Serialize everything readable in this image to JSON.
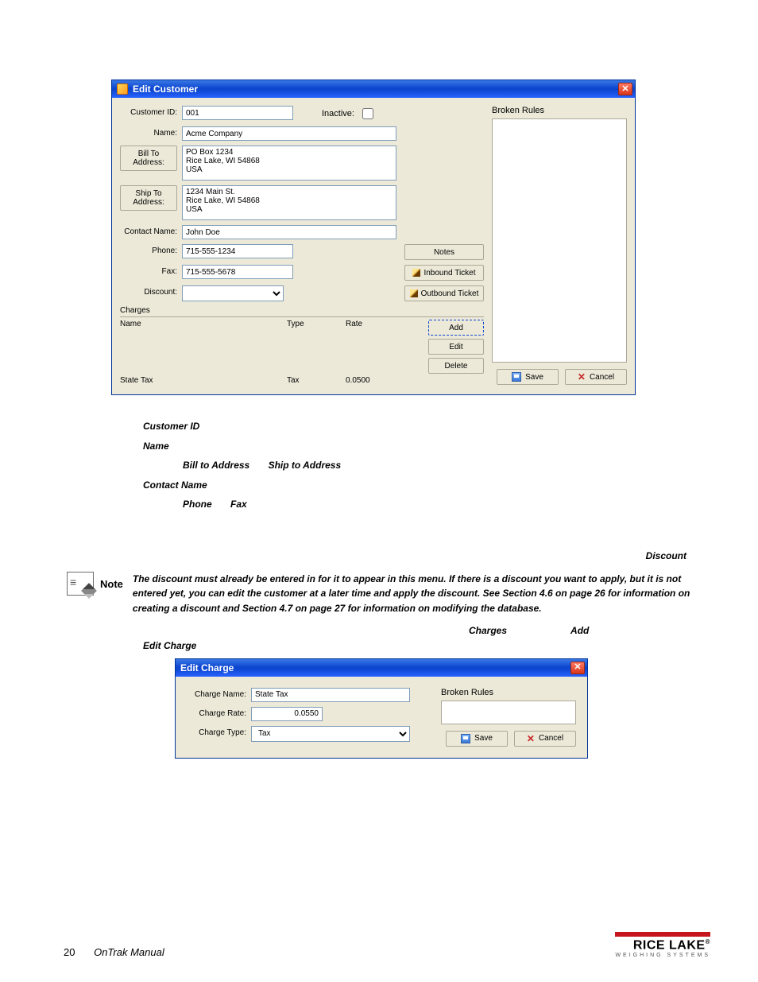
{
  "edit_customer": {
    "title": "Edit Customer",
    "close": "✕",
    "labels": {
      "customer_id": "Customer ID:",
      "inactive": "Inactive:",
      "name": "Name:",
      "bill_to": "Bill To Address:",
      "ship_to": "Ship To Address:",
      "contact_name": "Contact Name:",
      "phone": "Phone:",
      "fax": "Fax:",
      "discount": "Discount:"
    },
    "values": {
      "customer_id": "001",
      "name": "Acme Company",
      "bill_to": "PO Box 1234\nRice Lake, WI 54868\nUSA",
      "ship_to": "1234 Main St.\nRice Lake, WI 54868\nUSA",
      "contact_name": "John Doe",
      "phone": "715-555-1234",
      "fax": "715-555-5678",
      "discount": ""
    },
    "side_buttons": {
      "notes": "Notes",
      "inbound": "Inbound Ticket",
      "outbound": "Outbound Ticket"
    },
    "charges": {
      "header": "Charges",
      "cols": {
        "name": "Name",
        "type": "Type",
        "rate": "Rate"
      },
      "rows": [
        {
          "name": "State Tax",
          "type": "Tax",
          "rate": "0.0500"
        }
      ],
      "buttons": {
        "add": "Add",
        "edit": "Edit",
        "delete": "Delete"
      }
    },
    "broken_rules_label": "Broken Rules",
    "footer": {
      "save": "Save",
      "cancel": "Cancel"
    }
  },
  "doc": {
    "l1": "Customer ID",
    "l2": "Name",
    "l3a": "Bill to Address",
    "l3b": "Ship to Address",
    "l4": "Contact Name",
    "l5a": "Phone",
    "l5b": "Fax",
    "discount": "Discount",
    "note_label": "Note",
    "note_text": "The discount must already be entered in            for it to appear in this menu. If there is a discount you want to apply, but it is not entered yet, you can edit the customer at a later time and apply the discount. See Section 4.6 on page 26 for information on creating a discount and Section 4.7 on page 27 for information on modifying the database.",
    "charges": "Charges",
    "add": "Add",
    "edit_charge_label": "Edit Charge"
  },
  "edit_charge": {
    "title": "Edit Charge",
    "close": "✕",
    "labels": {
      "name": "Charge Name:",
      "rate": "Charge Rate:",
      "type": "Charge Type:"
    },
    "values": {
      "name": "State Tax",
      "rate": "0.0550",
      "type": "Tax"
    },
    "broken_rules_label": "Broken Rules",
    "footer": {
      "save": "Save",
      "cancel": "Cancel"
    }
  },
  "footer": {
    "page_num": "20",
    "manual": "OnTrak Manual",
    "brand": "RICE LAKE",
    "brand_sub": "WEIGHING SYSTEMS"
  }
}
